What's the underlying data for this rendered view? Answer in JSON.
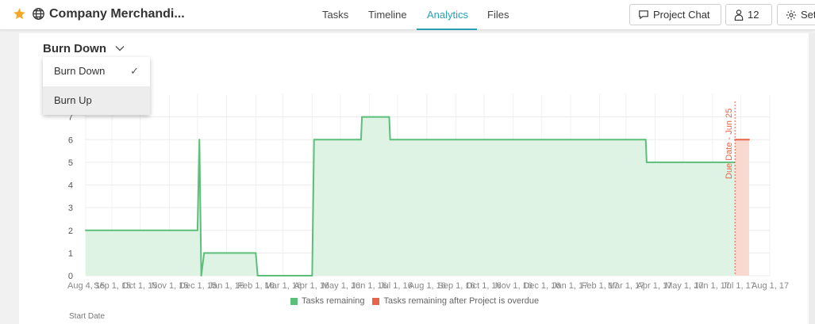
{
  "header": {
    "project_title": "Company Merchandi...",
    "star_icon": "star-icon",
    "globe_icon": "globe-icon",
    "tabs": [
      {
        "label": "Tasks",
        "active": false
      },
      {
        "label": "Timeline",
        "active": false
      },
      {
        "label": "Analytics",
        "active": true
      },
      {
        "label": "Files",
        "active": false
      }
    ],
    "project_chat_label": "Project Chat",
    "members_count": "12",
    "settings_label": "Set"
  },
  "report_select": {
    "selected": "Burn Down",
    "options": [
      {
        "label": "Burn Down",
        "checked": true
      },
      {
        "label": "Burn Up",
        "checked": false
      }
    ]
  },
  "colors": {
    "accent": "#2a9fb4",
    "remaining_line": "#5cbf79",
    "remaining_fill": "#dff3e4",
    "overdue_line": "#e8654a",
    "overdue_fill": "#f9d9cf",
    "star": "#f5a623"
  },
  "chart_data": {
    "type": "area",
    "title": "",
    "xlabel": "",
    "ylabel": "",
    "ylim": [
      0,
      8
    ],
    "y_ticks": [
      0,
      1,
      2,
      3,
      4,
      5,
      6,
      7
    ],
    "x_range": [
      "2015-08-04",
      "2017-08-01"
    ],
    "x_tick_labels": [
      "Aug 4, 15",
      "Sep 1, 15",
      "Oct 1, 15",
      "Nov 1, 15",
      "Dec 1, 15",
      "Jan 1, 16",
      "Feb 1, 16",
      "Mar 1, 16",
      "Apr 1, 16",
      "May 1, 16",
      "Jun 1, 16",
      "Jul 1, 16",
      "Aug 1, 16",
      "Sep 1, 16",
      "Oct 1, 16",
      "Nov 1, 16",
      "Dec 1, 16",
      "Jan 1, 17",
      "Feb 1, 17",
      "Mar 1, 17",
      "Apr 1, 17",
      "May 1, 17",
      "Jun 1, 17",
      "Jul 1, 17",
      "Aug 1, 17"
    ],
    "x_tick_dates": [
      "2015-08-04",
      "2015-09-01",
      "2015-10-01",
      "2015-11-01",
      "2015-12-01",
      "2016-01-01",
      "2016-02-01",
      "2016-03-01",
      "2016-04-01",
      "2016-05-01",
      "2016-06-01",
      "2016-07-01",
      "2016-08-01",
      "2016-09-01",
      "2016-10-01",
      "2016-11-01",
      "2016-12-01",
      "2017-01-01",
      "2017-02-01",
      "2017-03-01",
      "2017-04-01",
      "2017-05-01",
      "2017-06-01",
      "2017-07-01",
      "2017-08-01"
    ],
    "grid": true,
    "legend_position": "bottom",
    "series": [
      {
        "name": "Tasks remaining",
        "step": true,
        "points": [
          [
            "2015-08-04",
            2
          ],
          [
            "2015-12-01",
            2
          ],
          [
            "2015-12-03",
            6
          ],
          [
            "2015-12-05",
            0
          ],
          [
            "2015-12-08",
            1
          ],
          [
            "2016-02-01",
            1
          ],
          [
            "2016-02-03",
            0
          ],
          [
            "2016-04-01",
            0
          ],
          [
            "2016-04-03",
            6
          ],
          [
            "2016-05-23",
            6
          ],
          [
            "2016-05-24",
            7
          ],
          [
            "2016-06-22",
            7
          ],
          [
            "2016-06-23",
            6
          ],
          [
            "2017-03-22",
            6
          ],
          [
            "2017-03-23",
            5
          ],
          [
            "2017-06-25",
            5
          ]
        ]
      },
      {
        "name": "Tasks remaining after Project is overdue",
        "step": true,
        "points": [
          [
            "2017-06-25",
            6
          ],
          [
            "2017-07-10",
            6
          ]
        ]
      }
    ],
    "annotations": [
      {
        "date": "2017-06-25",
        "label": "Due Date - Jun 25"
      }
    ]
  },
  "footer": {
    "start_date_label": "Start Date"
  }
}
